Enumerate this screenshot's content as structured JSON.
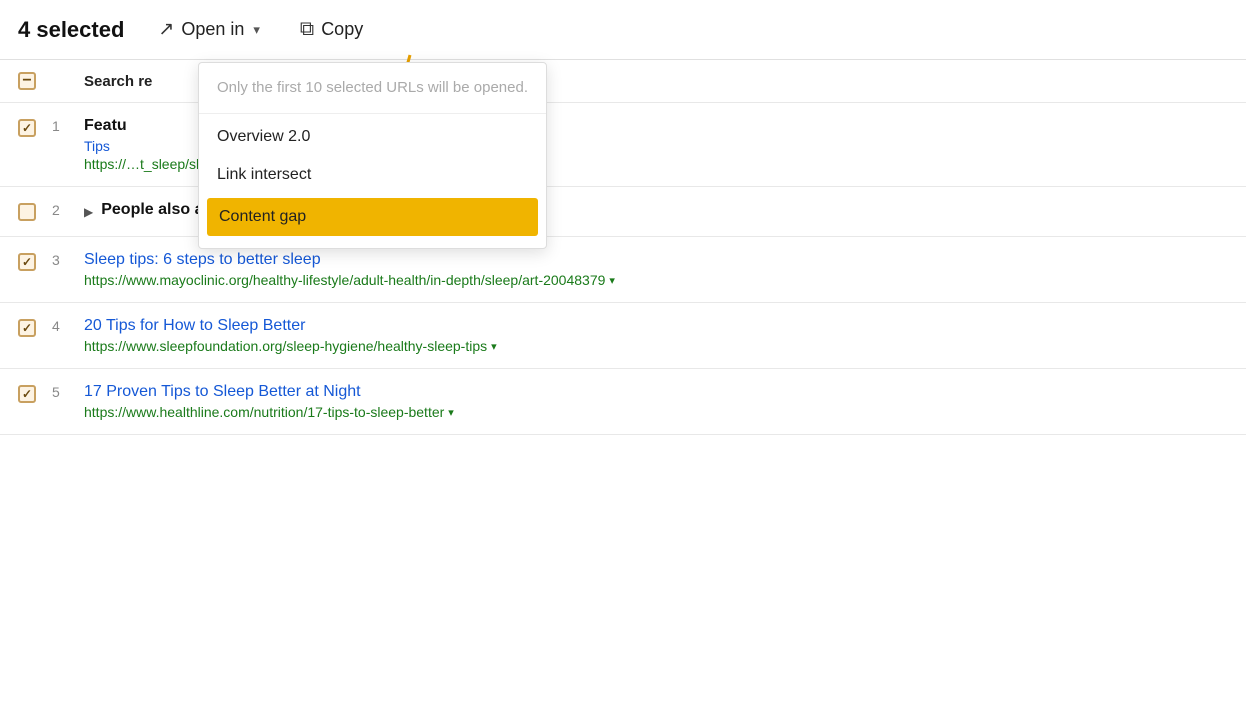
{
  "toolbar": {
    "selected_count": "4 selected",
    "open_in_label": "Open in",
    "copy_label": "Copy",
    "open_icon": "⬡",
    "copy_icon": "⧉"
  },
  "dropdown": {
    "hint": "Only the first 10 selected URLs will be opened.",
    "items": [
      {
        "label": "Overview 2.0",
        "active": false
      },
      {
        "label": "Link intersect",
        "active": false
      },
      {
        "label": "Content gap",
        "active": true
      }
    ]
  },
  "header_row": {
    "label": "Search re"
  },
  "results": [
    {
      "num": "1",
      "checked": true,
      "title": "Featu",
      "subtitle": "Tips",
      "url": "https://…t_sleep/sleep_hygiene.html",
      "type": "feature"
    },
    {
      "num": "2",
      "checked": false,
      "title": "People also ask",
      "type": "paa"
    },
    {
      "num": "3",
      "checked": true,
      "title": "Sleep tips: 6 steps to better sleep",
      "url": "https://www.mayoclinic.org/healthy-lifestyle/adult-health/in-depth/sleep/art-20048379",
      "type": "normal"
    },
    {
      "num": "4",
      "checked": true,
      "title": "20 Tips for How to Sleep Better",
      "url": "https://www.sleepfoundation.org/sleep-hygiene/healthy-sleep-tips",
      "type": "normal"
    },
    {
      "num": "5",
      "checked": true,
      "title": "17 Proven Tips to Sleep Better at Night",
      "url": "https://www.healthline.com/nutrition/17-tips-to-sleep-better",
      "type": "normal"
    }
  ],
  "colors": {
    "accent_orange": "#f0b400",
    "link_blue": "#1558d6",
    "url_green": "#1a7a1a",
    "checkbox_border": "#c8a060",
    "checkbox_bg": "#fdf3e3"
  }
}
